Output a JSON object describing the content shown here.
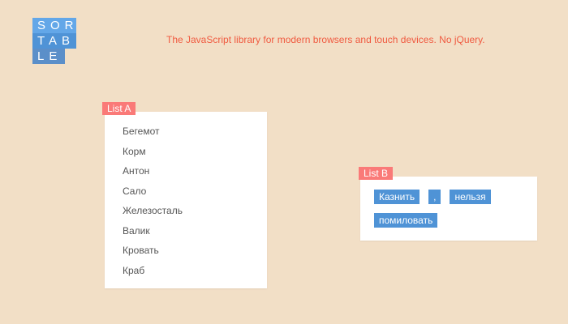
{
  "logo": {
    "rows": [
      "SOR",
      "TAB",
      "LE"
    ]
  },
  "tagline": "The JavaScript library for modern browsers and touch devices. No jQuery.",
  "list_a": {
    "label": "List A",
    "items": [
      "Бегемот",
      "Корм",
      "Антон",
      "Сало",
      "Железосталь",
      "Валик",
      "Кровать",
      "Краб"
    ]
  },
  "list_b": {
    "label": "List B",
    "items": [
      "Казнить",
      ",",
      "нельзя",
      "помиловать"
    ]
  },
  "colors": {
    "background": "#f2dfc6",
    "tagline": "#f05a40",
    "list_tag": "#fa7a78",
    "chip": "#4f93d6",
    "logo_light": "#63a7e8",
    "logo_dark": "#5b8fc9"
  }
}
